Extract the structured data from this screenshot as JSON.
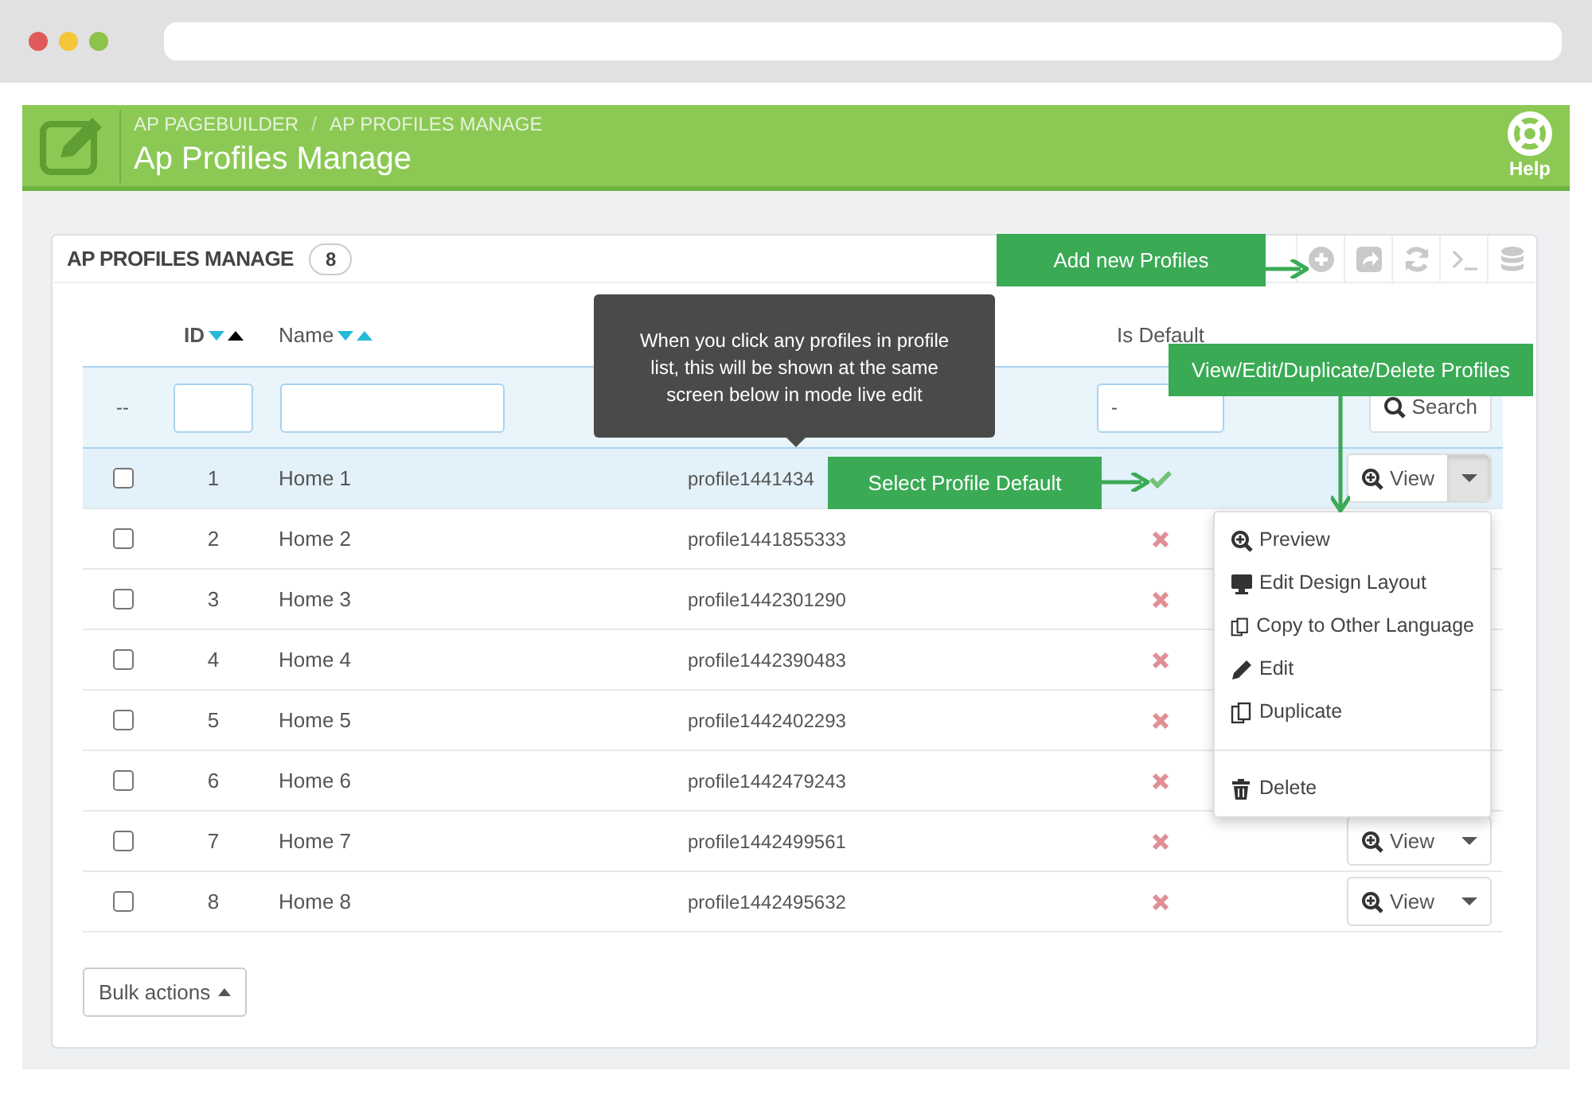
{
  "browser": {
    "dots": [
      {
        "color": "#e05a5a"
      },
      {
        "color": "#f5c53a"
      },
      {
        "color": "#8cc34b"
      }
    ]
  },
  "header": {
    "breadcrumbs": [
      "AP PAGEBUILDER",
      "AP PROFILES MANAGE"
    ],
    "separator": "/",
    "title": "Ap Profiles Manage",
    "help": "Help"
  },
  "panel": {
    "title": "AP PROFILES MANAGE",
    "count": "8"
  },
  "table": {
    "columns": [
      {
        "label": "ID",
        "sortable": true,
        "sorted": true
      },
      {
        "label": "Name",
        "sortable": true,
        "sorted": false
      },
      {
        "label": "Is Default"
      }
    ],
    "filters": {
      "reset": "--",
      "is_default": "-",
      "search": "Search"
    },
    "rows": [
      {
        "id": "1",
        "name": "Home 1",
        "profile": "profile1441434",
        "checked": false,
        "is_default": true,
        "selected": true,
        "action": "View",
        "menu_open": true
      },
      {
        "id": "2",
        "name": "Home 2",
        "profile": "profile1441855333",
        "checked": false,
        "is_default": false,
        "selected": false
      },
      {
        "id": "3",
        "name": "Home 3",
        "profile": "profile1442301290",
        "checked": false,
        "is_default": false,
        "selected": false
      },
      {
        "id": "4",
        "name": "Home 4",
        "profile": "profile1442390483",
        "checked": false,
        "is_default": false,
        "selected": false
      },
      {
        "id": "5",
        "name": "Home 5",
        "profile": "profile1442402293",
        "checked": false,
        "is_default": false,
        "selected": false
      },
      {
        "id": "6",
        "name": "Home 6",
        "profile": "profile1442479243",
        "checked": false,
        "is_default": false,
        "selected": false
      },
      {
        "id": "7",
        "name": "Home 7",
        "profile": "profile1442499561",
        "checked": false,
        "is_default": false,
        "selected": false,
        "action": "View",
        "menu_open": false
      },
      {
        "id": "8",
        "name": "Home 8",
        "profile": "profile1442495632",
        "checked": false,
        "is_default": false,
        "selected": false,
        "action": "View",
        "menu_open": false
      }
    ]
  },
  "menu": {
    "items": [
      {
        "label": "Preview",
        "kind": "zoom",
        "divider_before": false
      },
      {
        "label": "Edit Design Layout",
        "kind": "monitor",
        "divider_before": false
      },
      {
        "label": "Copy to Other Language",
        "kind": "copy",
        "divider_before": false
      },
      {
        "label": "Edit",
        "kind": "pencil",
        "divider_before": false
      },
      {
        "label": "Duplicate",
        "kind": "copy",
        "divider_before": false
      },
      {
        "label": "Delete",
        "kind": "trash",
        "divider_before": true
      }
    ]
  },
  "bulk_actions": "Bulk actions",
  "tooltip": "When you click any profiles in profile list, this will be shown at the same screen below in mode live edit",
  "callouts": [
    {
      "text": "Add new Profiles",
      "kind": "add"
    },
    {
      "text": "View/Edit/Duplicate/Delete Profiles",
      "kind": "actions"
    },
    {
      "text": "Select Profile Default",
      "kind": "default"
    }
  ]
}
